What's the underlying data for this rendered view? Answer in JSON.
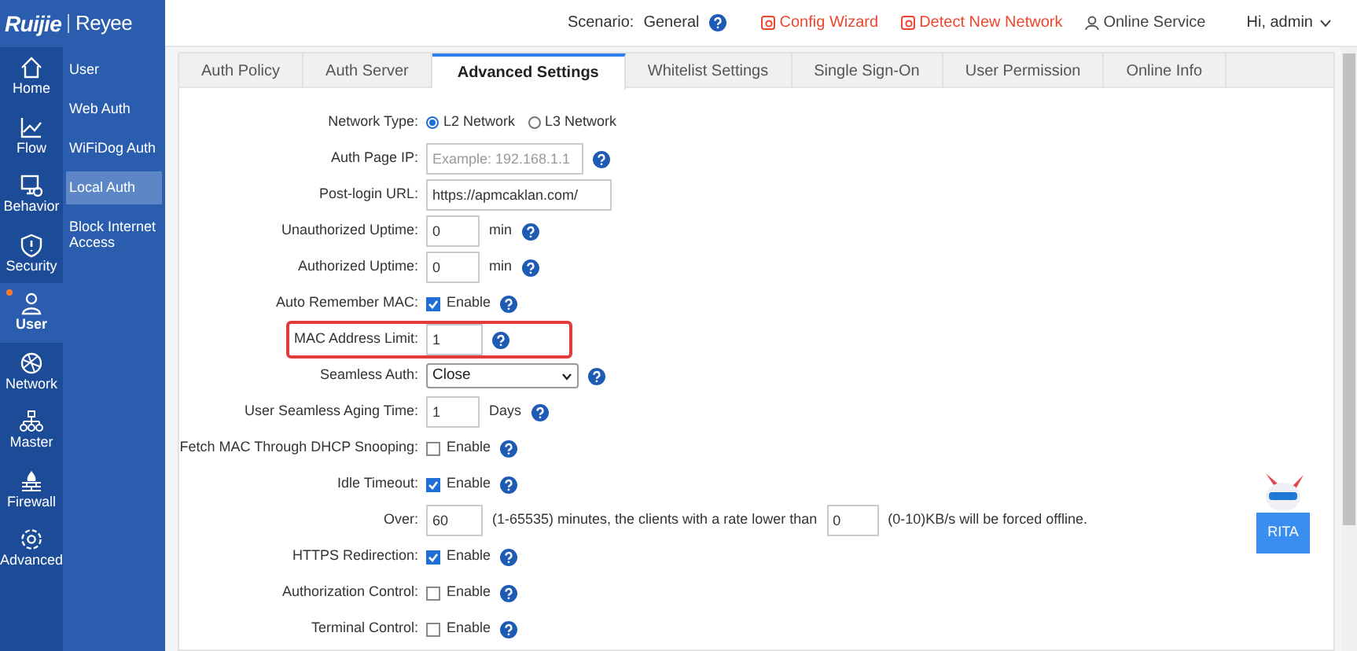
{
  "logo": {
    "brand": "Ruijie",
    "sub_brand": "Reyee"
  },
  "header": {
    "scenario_label": "Scenario:",
    "scenario_value": "General",
    "links": [
      {
        "label": "Config Wizard",
        "kind": "alert"
      },
      {
        "label": "Detect New Network",
        "kind": "alert"
      },
      {
        "label": "Online Service",
        "kind": "person"
      }
    ],
    "user": "Hi, admin"
  },
  "rail": [
    {
      "label": "Home",
      "selected": false,
      "badge": false
    },
    {
      "label": "Flow",
      "selected": false,
      "badge": false
    },
    {
      "label": "Behavior",
      "selected": false,
      "badge": false
    },
    {
      "label": "Security",
      "selected": false,
      "badge": false
    },
    {
      "label": "User",
      "selected": true,
      "badge": true
    },
    {
      "label": "Network",
      "selected": false,
      "badge": false
    },
    {
      "label": "Master",
      "selected": false,
      "badge": false
    },
    {
      "label": "Firewall",
      "selected": false,
      "badge": false
    },
    {
      "label": "Advanced",
      "selected": false,
      "badge": false
    }
  ],
  "submenu": [
    {
      "label": "User",
      "selected": false
    },
    {
      "label": "Web Auth",
      "selected": false
    },
    {
      "label": "WiFiDog Auth",
      "selected": false
    },
    {
      "label": "Local Auth",
      "selected": true
    },
    {
      "label": "Block Internet Access",
      "selected": false
    }
  ],
  "tabs": [
    {
      "label": "Auth Policy",
      "selected": false
    },
    {
      "label": "Auth Server",
      "selected": false
    },
    {
      "label": "Advanced Settings",
      "selected": true
    },
    {
      "label": "Whitelist Settings",
      "selected": false
    },
    {
      "label": "Single Sign-On",
      "selected": false
    },
    {
      "label": "User Permission",
      "selected": false
    },
    {
      "label": "Online Info",
      "selected": false
    }
  ],
  "form": [
    {
      "kind": "radio",
      "label": "Network Type:",
      "options": [
        {
          "label": "L2 Network",
          "selected": true
        },
        {
          "label": "L3 Network",
          "selected": false
        }
      ],
      "help": false,
      "highlighted": false
    },
    {
      "kind": "text",
      "label": "Auth Page IP:",
      "placeholder": "Example: 192.168.1.1",
      "help": true,
      "highlighted": false
    },
    {
      "kind": "text",
      "label": "Post-login URL:",
      "value": "https://apmcaklan.com/",
      "help": false,
      "highlighted": false
    },
    {
      "kind": "number",
      "label": "Unauthorized Uptime:",
      "value": "0",
      "unit": "min",
      "help": true,
      "highlighted": false
    },
    {
      "kind": "number",
      "label": "Authorized Uptime:",
      "value": "0",
      "unit": "min",
      "help": true,
      "highlighted": false
    },
    {
      "kind": "checkbox",
      "label": "Auto Remember MAC:",
      "option": "Enable",
      "checked": true,
      "help": true,
      "highlighted": false
    },
    {
      "kind": "number",
      "label": "MAC Address Limit:",
      "value": "1",
      "help": true,
      "highlighted": true
    },
    {
      "kind": "select",
      "label": "Seamless Auth:",
      "value": "Close",
      "help": true,
      "highlighted": false
    },
    {
      "kind": "number",
      "label": "User Seamless Aging Time:",
      "value": "1",
      "unit": "Days",
      "help": true,
      "highlighted": false
    },
    {
      "kind": "checkbox",
      "label": "Fetch MAC Through DHCP Snooping:",
      "option": "Enable",
      "checked": false,
      "help": true,
      "highlighted": false
    },
    {
      "kind": "checkbox",
      "label": "Idle Timeout:",
      "option": "Enable",
      "checked": true,
      "help": true,
      "highlighted": false
    },
    {
      "kind": "compound",
      "label": "Over:",
      "value": "60",
      "text": "(1-65535) minutes, the clients with a rate lower than",
      "value_2": "0",
      "text_2": "(0-10)KB/s will be forced offline.",
      "help": false,
      "highlighted": false
    },
    {
      "kind": "checkbox",
      "label": "HTTPS Redirection:",
      "option": "Enable",
      "checked": true,
      "help": true,
      "highlighted": false
    },
    {
      "kind": "checkbox",
      "label": "Authorization Control:",
      "option": "Enable",
      "checked": false,
      "help": true,
      "highlighted": false
    },
    {
      "kind": "checkbox",
      "label": "Terminal Control:",
      "option": "Enable",
      "checked": false,
      "help": true,
      "highlighted": false
    }
  ],
  "assistant": {
    "label": "RITA"
  }
}
